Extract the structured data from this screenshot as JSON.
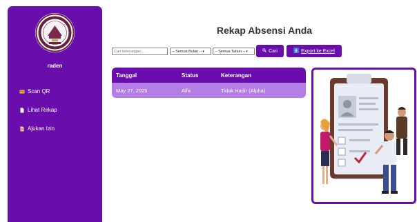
{
  "sidebar": {
    "username": "raden",
    "items": [
      {
        "label": "Scan QR",
        "icon": "id-card-icon"
      },
      {
        "label": "Lihat Rekap",
        "icon": "document-icon"
      },
      {
        "label": "Ajukan Izin",
        "icon": "document-icon"
      }
    ]
  },
  "main": {
    "title": "Rekap Absensi Anda",
    "filters": {
      "search_placeholder": "Cari keterangan...",
      "month_select": "-- Semua Bulan --",
      "year_select": "-- Semua Tahun --",
      "search_button": "Cari",
      "export_button": "Export ke Excel"
    },
    "table": {
      "headers": [
        "Tanggal",
        "Status",
        "Keterangan"
      ],
      "rows": [
        [
          "May 27, 2025",
          "Alfa",
          "Tidak Hadir (Alpha)"
        ]
      ]
    }
  },
  "colors": {
    "primary": "#6a0dad",
    "row": "#b57ee6",
    "export_icon": "#3a7bd5"
  }
}
